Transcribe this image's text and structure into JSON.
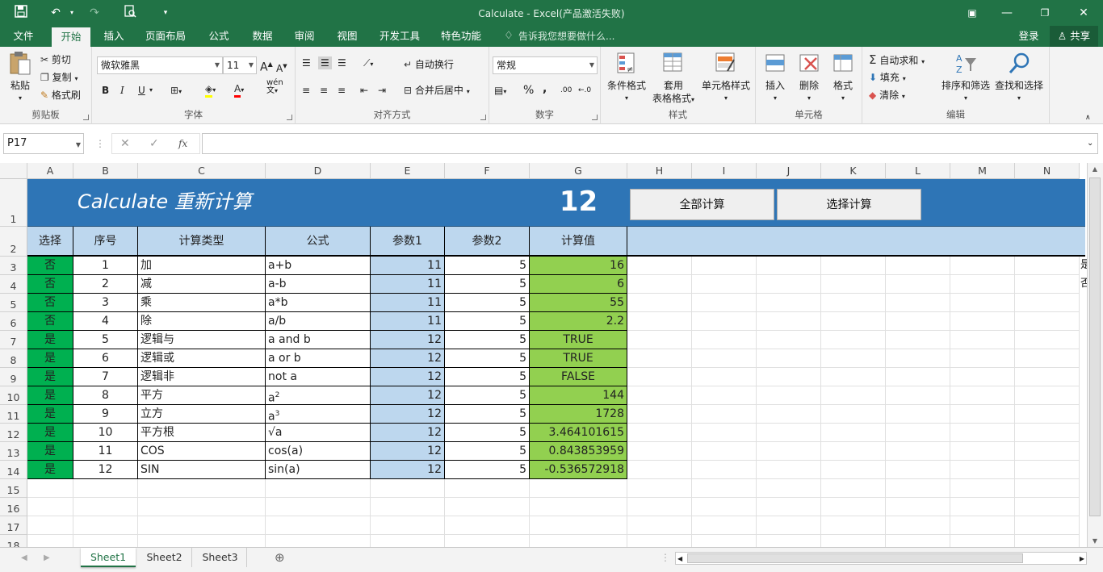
{
  "window": {
    "title": "Calculate - Excel(产品激活失败)"
  },
  "menu": {
    "tabs": [
      "文件",
      "开始",
      "插入",
      "页面布局",
      "公式",
      "数据",
      "审阅",
      "视图",
      "开发工具",
      "特色功能"
    ],
    "active": "开始",
    "tellme": "告诉我您想要做什么...",
    "login": "登录",
    "share": "共享"
  },
  "ribbon": {
    "clipboard": {
      "paste": "粘贴",
      "cut": "剪切",
      "copy": "复制",
      "format_painter": "格式刷",
      "label": "剪贴板"
    },
    "font": {
      "name": "微软雅黑",
      "size": "11",
      "label": "字体",
      "bold": "B",
      "italic": "I",
      "underline": "U",
      "grow": "A",
      "shrink": "A",
      "color_a": "A",
      "wen": "wén"
    },
    "alignment": {
      "wrap": "自动换行",
      "merge": "合并后居中",
      "label": "对齐方式"
    },
    "number": {
      "format": "常规",
      "percent": "%",
      "comma": ",",
      "dec_inc": ".00",
      "dec_dec": "←.0",
      "label": "数字"
    },
    "styles": {
      "conditional": "条件格式",
      "table_1": "套用",
      "table_2": "表格格式",
      "cell_styles": "单元格样式",
      "label": "样式"
    },
    "cells": {
      "insert": "插入",
      "delete": "删除",
      "format": "格式",
      "label": "单元格"
    },
    "editing": {
      "autosum": "自动求和",
      "fill": "填充",
      "clear": "清除",
      "sort": "排序和筛选",
      "find": "查找和选择",
      "label": "编辑"
    }
  },
  "formula_bar": {
    "name_box": "P17",
    "fx": "fx",
    "value": ""
  },
  "sheet": {
    "columns": [
      "A",
      "B",
      "C",
      "D",
      "E",
      "F",
      "G",
      "H",
      "I",
      "J",
      "K",
      "L",
      "M",
      "N"
    ],
    "rows": [
      "1",
      "2",
      "3",
      "4",
      "5",
      "6",
      "7",
      "8",
      "9",
      "10",
      "11",
      "12",
      "13",
      "14",
      "15",
      "16",
      "17",
      "18"
    ],
    "banner_title": "Calculate 重新计算",
    "banner_value": "12",
    "btn_all": "全部计算",
    "btn_select": "选择计算",
    "headers": [
      "选择",
      "序号",
      "计算类型",
      "公式",
      "参数1",
      "参数2",
      "计算值"
    ],
    "data": [
      [
        "否",
        "1",
        "加",
        "a+b",
        "11",
        "5",
        "16"
      ],
      [
        "否",
        "2",
        "减",
        "a-b",
        "11",
        "5",
        "6"
      ],
      [
        "否",
        "3",
        "乘",
        "a*b",
        "11",
        "5",
        "55"
      ],
      [
        "否",
        "4",
        "除",
        "a/b",
        "11",
        "5",
        "2.2"
      ],
      [
        "是",
        "5",
        "逻辑与",
        "a and b",
        "12",
        "5",
        "TRUE"
      ],
      [
        "是",
        "6",
        "逻辑或",
        "a or b",
        "12",
        "5",
        "TRUE"
      ],
      [
        "是",
        "7",
        "逻辑非",
        "not a",
        "12",
        "5",
        "FALSE"
      ],
      [
        "是",
        "8",
        "平方",
        "a2",
        "12",
        "5",
        "144"
      ],
      [
        "是",
        "9",
        "立方",
        "a3",
        "12",
        "5",
        "1728"
      ],
      [
        "是",
        "10",
        "平方根",
        "√a",
        "12",
        "5",
        "3.464101615"
      ],
      [
        "是",
        "11",
        "COS",
        "cos(a)",
        "12",
        "5",
        "0.843853959"
      ],
      [
        "是",
        "12",
        "SIN",
        "sin(a)",
        "12",
        "5",
        "-0.536572918"
      ]
    ],
    "overflow_n3": "是",
    "overflow_n4": "否"
  },
  "sheet_tabs": [
    "Sheet1",
    "Sheet2",
    "Sheet3"
  ],
  "colors": {
    "excel_green": "#217346",
    "banner": "#2e75b6",
    "header_row": "#bdd7ee",
    "select_col": "#00b050",
    "param1_col": "#bdd7ee",
    "result_col": "#92d050"
  }
}
